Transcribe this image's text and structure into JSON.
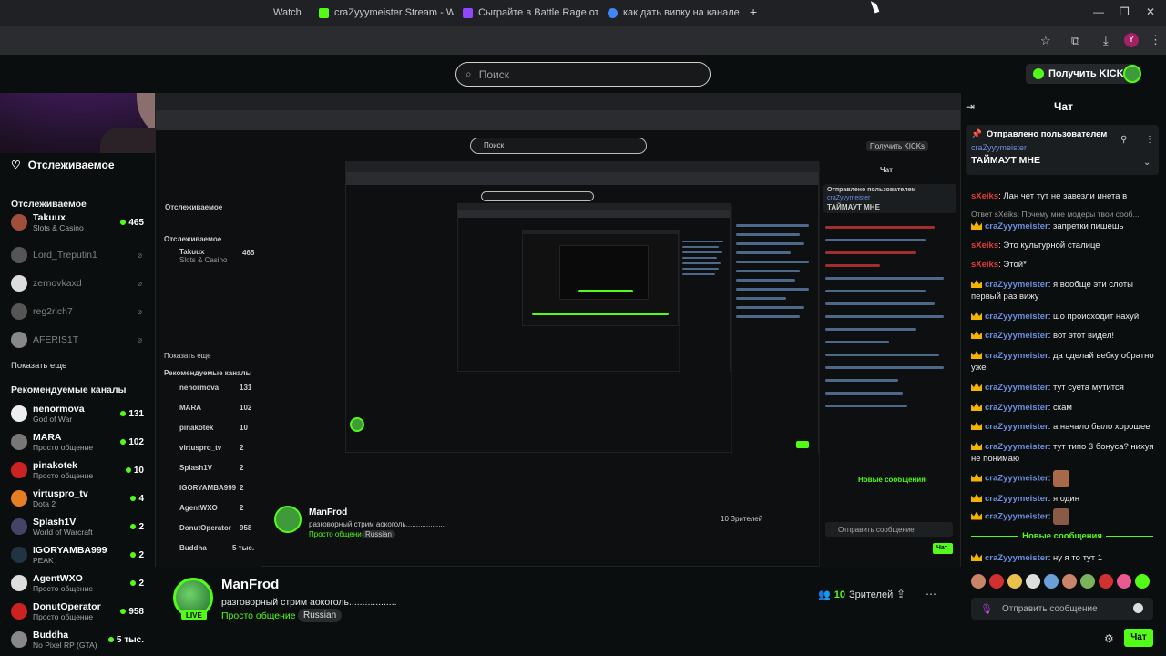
{
  "browser": {
    "tabs": [
      {
        "label": "Watch",
        "color": "#3a3a3a"
      },
      {
        "label": "craZyyymeister Stream - Watch",
        "color": "#53fc18"
      },
      {
        "label": "Сыграйте в Battle Rage от Tru",
        "color": "#9146ff"
      },
      {
        "label": "как дать випку на канале кик",
        "color": "#4285f4"
      }
    ],
    "new_tab": "+",
    "minimize": "—",
    "maximize": "❐",
    "close": "✕",
    "profile_letter": "Y"
  },
  "header": {
    "search_placeholder": "Поиск",
    "kicks_button": "Получить KICKs"
  },
  "sidebar": {
    "following_title": "Отслеживаемое",
    "following_section": "Отслеживаемое",
    "followed": [
      {
        "name": "Takuux",
        "category": "Slots & Casino",
        "viewers": "465",
        "live": true,
        "color": "#a0503a"
      },
      {
        "name": "Lord_Treputin1",
        "live": false,
        "color": "#555"
      },
      {
        "name": "zernovkaxd",
        "live": false,
        "color": "#ddd"
      },
      {
        "name": "reg2rich7",
        "live": false,
        "color": "#555"
      },
      {
        "name": "AFERIS1T",
        "live": false,
        "color": "#888"
      }
    ],
    "show_more": "Показать еще",
    "recommended_title": "Рекомендуемые каналы",
    "recommended": [
      {
        "name": "nenormova",
        "category": "God of War",
        "viewers": "131",
        "color": "#eee"
      },
      {
        "name": "MARA",
        "category": "Просто общение",
        "viewers": "102",
        "color": "#777"
      },
      {
        "name": "pinakotek",
        "category": "Просто общение",
        "viewers": "10",
        "color": "#c22"
      },
      {
        "name": "virtuspro_tv",
        "category": "Dota 2",
        "viewers": "4",
        "color": "#e67e22"
      },
      {
        "name": "Splash1V",
        "category": "World of Warcraft",
        "viewers": "2",
        "color": "#446"
      },
      {
        "name": "IGORYAMBA999",
        "category": "PEAK",
        "viewers": "2",
        "color": "#234"
      },
      {
        "name": "AgentWXO",
        "category": "Просто общение",
        "viewers": "2",
        "color": "#ddd"
      },
      {
        "name": "DonutOperator",
        "category": "Просто общение",
        "viewers": "958",
        "color": "#c22"
      },
      {
        "name": "Buddha",
        "category": "No Pixel RP (GTA)",
        "viewers": "5 тыс.",
        "color": "#888"
      }
    ]
  },
  "stream": {
    "name": "ManFrod",
    "title": "разговорный стрим аокоголь..................",
    "category": "Просто общение",
    "tag": "Russian",
    "viewers": "10",
    "viewers_label": "Зрителей",
    "live": "LIVE"
  },
  "nested": {
    "name": "ManFrod",
    "title": "разговорный стрим аокоголь...................",
    "category": "Просто общение",
    "tag": "Russian",
    "viewers": "10 Зрителей",
    "chat_title": "Чат",
    "send": "Чат",
    "input": "Отправить сообщение",
    "new_messages": "Новые сообщения",
    "search": "Поиск",
    "kicks": "Получить KICKs",
    "pinned_label": "Отправлено пользователем",
    "pinned_user": "craZyyymeister",
    "pinned_msg": "ТАЙМАУТ МНЕ",
    "following": "Отслеживаемое",
    "following_sub": "Отслеживаемое",
    "takuux": "Takuux",
    "takuux_cat": "Slots & Casino",
    "takuux_viewers": "465",
    "show_more": "Показать еще",
    "recommended": "Рекомендуемые каналы",
    "rec_names": [
      "nenormova",
      "MARA",
      "pinakotek",
      "virtuspro_tv",
      "Splash1V",
      "IGORYAMBA999",
      "AgentWXO",
      "DonutOperator",
      "Buddha"
    ],
    "rec_counts": [
      "131",
      "102",
      "10",
      "2",
      "2",
      "2",
      "2",
      "958",
      "5 тыс."
    ]
  },
  "chat": {
    "title": "Чат",
    "pinned": {
      "label": "Отправлено пользователем",
      "user": "craZyyymeister",
      "message": "ТАЙМАУТ МНЕ"
    },
    "messages": [
      {
        "user": "sXeiks",
        "text": ": Лан чет тут не завезли инета в",
        "color": "#e23a3a",
        "crown": false
      },
      {
        "user": "craZyyymeister",
        "text": ": запретки пишешь",
        "color": "#6b8fde",
        "crown": true
      },
      {
        "user": "sXeiks",
        "text": ": Это культурной сталице",
        "color": "#e23a3a",
        "crown": false
      },
      {
        "user": "sXeiks",
        "text": ": Этой*",
        "color": "#e23a3a",
        "crown": false
      },
      {
        "user": "craZyyymeister",
        "text": ": я вообще эти слоты первый раз вижу",
        "color": "#6b8fde",
        "crown": true
      },
      {
        "user": "craZyyymeister",
        "text": ": шо происходит нахуй",
        "color": "#6b8fde",
        "crown": true
      },
      {
        "user": "craZyyymeister",
        "text": ": вот этот видел!",
        "color": "#6b8fde",
        "crown": true
      },
      {
        "user": "craZyyymeister",
        "text": ": да сделай вебку обратно уже",
        "color": "#6b8fde",
        "crown": true
      },
      {
        "user": "craZyyymeister",
        "text": ": тут суета мутится",
        "color": "#6b8fde",
        "crown": true
      },
      {
        "user": "craZyyymeister",
        "text": ": скам",
        "color": "#6b8fde",
        "crown": true
      },
      {
        "user": "craZyyymeister",
        "text": ": а начало было хорошее",
        "color": "#6b8fde",
        "crown": true
      },
      {
        "user": "craZyyymeister",
        "text": ": тут типо 3 бонуса? нихуя не понимаю",
        "color": "#6b8fde",
        "crown": true
      },
      {
        "user": "craZyyymeister",
        "text": ":",
        "color": "#6b8fde",
        "crown": true
      },
      {
        "user": "craZyyymeister",
        "text": ": я один",
        "color": "#6b8fde",
        "crown": true
      },
      {
        "user": "craZyyymeister",
        "text": ":",
        "color": "#6b8fde",
        "crown": true
      }
    ],
    "new_messages": "Новые сообщения",
    "after_new": {
      "user": "craZyyymeister",
      "text": ": ну я то тут 1",
      "color": "#6b8fde"
    },
    "reply_preview": "Ответ sXeiks: Почему мне модеры твои сооб...",
    "input_placeholder": "Отправить сообщение",
    "send_label": "Чат"
  }
}
